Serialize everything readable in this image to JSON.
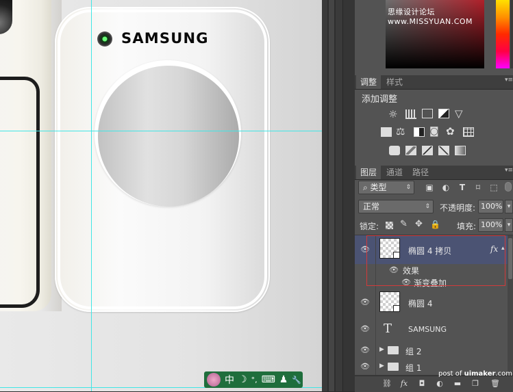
{
  "canvas": {
    "logo_text": "SAMSUNG"
  },
  "ime_bar": {
    "mode_label": "中",
    "moon_glyph": "☽",
    "punct_label": "°,",
    "keyboard_glyph": "⌨",
    "person_glyph": "♟",
    "wrench_glyph": "🔧"
  },
  "watermark_top": "思缘设计论坛 www.MISSYUAN.COM",
  "watermark_bottom": {
    "prefix": "post of ",
    "site": "uimaker",
    "suffix": ".com"
  },
  "adjust_panel": {
    "tabs": [
      "调整",
      "样式"
    ],
    "title": "添加调整"
  },
  "layers_panel": {
    "tabs": [
      "图层",
      "通道",
      "路径"
    ],
    "filter_label": "类型",
    "blend_mode": "正常",
    "opacity_label": "不透明度:",
    "opacity_value": "100%",
    "lock_label": "锁定:",
    "fill_label": "填充:",
    "fill_value": "100%",
    "layers": [
      {
        "name": "椭圆 4 拷贝",
        "selected": true,
        "fx": "fx"
      },
      {
        "effects_label": "效果"
      },
      {
        "effect_name": "渐变叠加"
      },
      {
        "name": "椭圆 4"
      },
      {
        "name": "SAMSUNG",
        "type_glyph": "T"
      },
      {
        "name": "组 2"
      },
      {
        "name": "组 1"
      }
    ]
  },
  "colors": {
    "guide": "#3fe6e6",
    "selected_layer": "#4b5373",
    "panel_bg": "#535353"
  }
}
